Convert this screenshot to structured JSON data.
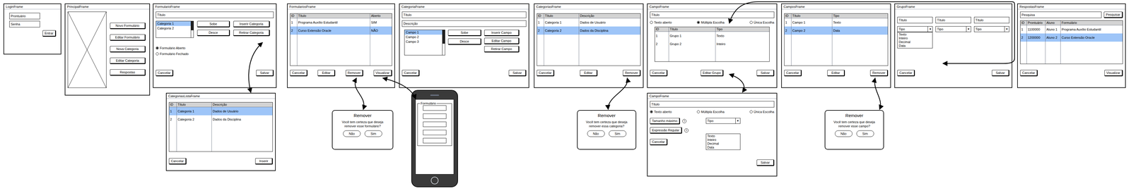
{
  "login": {
    "title": "LoginFrame",
    "fields": [
      "Prontuário",
      "Senha"
    ],
    "button": "Entrar"
  },
  "principal": {
    "title": "PrincipalFrame",
    "buttons": [
      "Novo Formulário",
      "Editar Formulário",
      "Nova Categoria",
      "Editar Categoria",
      "Respostas"
    ]
  },
  "formulario": {
    "title": "FormularioFrame",
    "field": "Título",
    "list": [
      {
        "label": "Categoria 1",
        "selected": true
      },
      {
        "label": "Categoria 2",
        "selected": false
      }
    ],
    "move_buttons": [
      "Sobe",
      "Desce"
    ],
    "action_buttons": [
      "Inserir Categoria",
      "Retirar Categoria"
    ],
    "radios": [
      {
        "label": "Formulário Aberto",
        "selected": true
      },
      {
        "label": "Formulário Fechado",
        "selected": false
      }
    ],
    "buttons": [
      "Cancelar",
      "Salvar"
    ]
  },
  "formularios": {
    "title": "FormulariosFrame",
    "table": {
      "columns": [
        "ID",
        "Título",
        "Aberto"
      ],
      "rows": [
        {
          "cells": [
            "1",
            "Programa Auxílio Estudantil",
            "SIM"
          ],
          "selected": false
        },
        {
          "cells": [
            "2",
            "Curso Extensão Oracle",
            "NÃO"
          ],
          "selected": true
        }
      ]
    },
    "buttons": [
      "Cancelar",
      "Editar",
      "Remover",
      "Visualizar"
    ]
  },
  "categoria": {
    "title": "CategoriaFrame",
    "fields": [
      "Título",
      "Descrição"
    ],
    "list": [
      {
        "label": "Campo 1",
        "selected": true
      },
      {
        "label": "Campo 2",
        "selected": false
      },
      {
        "label": "Campo 3",
        "selected": false
      }
    ],
    "move_buttons": [
      "Sobe",
      "Desce"
    ],
    "action_buttons": [
      "Inserir Campo",
      "Editar Campo",
      "Retirar Campo"
    ],
    "buttons": [
      "Cancelar",
      "Salvar"
    ]
  },
  "categorias": {
    "title": "CategoriasFrame",
    "table": {
      "columns": [
        "ID",
        "Título",
        "Descrição"
      ],
      "rows": [
        {
          "cells": [
            "1",
            "Categoria 1",
            "Dados de Usuário"
          ],
          "selected": false
        },
        {
          "cells": [
            "2",
            "Categoria 2",
            "Dados da Disciplina"
          ],
          "selected": true
        }
      ]
    },
    "buttons": [
      "Cancelar",
      "Editar",
      "Remover"
    ]
  },
  "campo": {
    "title": "CampoFrame",
    "field": "Título",
    "radios": [
      {
        "label": "Texto aberto",
        "selected": false
      },
      {
        "label": "Múltipla Escolha",
        "selected": true
      },
      {
        "label": "Única Escolha",
        "selected": false
      }
    ],
    "table": {
      "columns": [
        "ID",
        "Título",
        "Tipo"
      ],
      "rows": [
        {
          "cells": [
            "1",
            "Grupo 1",
            "Texto"
          ],
          "selected": false
        },
        {
          "cells": [
            "2",
            "Grupo 2",
            "Inteiro"
          ],
          "selected": false
        }
      ]
    },
    "buttons": [
      "Cancelar",
      "Editar Grupo",
      "Salvar"
    ]
  },
  "campos": {
    "title": "CamposFrame",
    "table": {
      "columns": [
        "ID",
        "Título",
        "Tipo"
      ],
      "rows": [
        {
          "cells": [
            "1",
            "Campo 1",
            "Texto"
          ],
          "selected": false
        },
        {
          "cells": [
            "2",
            "Campo 2",
            "Data"
          ],
          "selected": true
        }
      ]
    },
    "buttons": [
      "Cancelar",
      "Editar",
      "Remover"
    ]
  },
  "grupo": {
    "title": "GrupoFrame",
    "columns": [
      {
        "field": "Título",
        "dropdown": {
          "label": "Tipo",
          "arrow": "▼",
          "open": true,
          "options": [
            "Texto",
            "Inteiro",
            "Decimal",
            "Data"
          ]
        }
      },
      {
        "field": "Título",
        "dropdown": {
          "label": "Tipo",
          "arrow": "▼",
          "open": false
        }
      },
      {
        "field": "Título",
        "dropdown": {
          "label": "Tipo",
          "arrow": "▼",
          "open": false
        }
      }
    ],
    "buttons": [
      "Cancelar",
      "Salvar"
    ]
  },
  "respostas": {
    "title": "RespostasFrame",
    "search": {
      "placeholder": "Pesquisa",
      "button": "Pesquisar"
    },
    "table": {
      "columns": [
        "ID",
        "Prontuário",
        "Aluno",
        "Formulário"
      ],
      "rows": [
        {
          "cells": [
            "1",
            "1100000",
            "Aluno 1",
            "Programa Auxílio Estudantil"
          ],
          "selected": false
        },
        {
          "cells": [
            "2",
            "1200000",
            "Aluno 2",
            "Curso Extensão Oracle"
          ],
          "selected": true
        }
      ]
    },
    "buttons": [
      "Cancelar",
      "Visualizar"
    ]
  },
  "categorias_lista": {
    "title": "CategoriasListaFrame",
    "table": {
      "columns": [
        "ID",
        "Título",
        "Descrição"
      ],
      "rows": [
        {
          "cells": [
            "1",
            "Categoria 1",
            "Dados de Usuário"
          ],
          "selected": true
        },
        {
          "cells": [
            "2",
            "Categoria 2",
            "Dados da Disciplina"
          ],
          "selected": false
        }
      ]
    },
    "buttons": [
      "Cancelar",
      "Inserir"
    ]
  },
  "dialogs": [
    {
      "title": "Remover",
      "message": "Você tem certeza que deseja remover esse formulário?",
      "buttons": [
        "Não",
        "Sim"
      ]
    },
    {
      "title": "Remover",
      "message": "Você tem certeza que deseja remover essa categoria?",
      "buttons": [
        "Não",
        "Sim"
      ]
    },
    {
      "title": "Remover",
      "message": "Você tem certeza que deseja remover esse campo?",
      "buttons": [
        "Não",
        "Sim"
      ]
    }
  ],
  "phone": {
    "legend": "Formulário"
  },
  "campo_detalhe": {
    "title": "CampoFrame",
    "field": "Título",
    "radios": [
      {
        "label": "Texto aberto",
        "selected": true
      },
      {
        "label": "Múltipla Escolha",
        "selected": false
      },
      {
        "label": "Única Escolha",
        "selected": false
      }
    ],
    "options": [
      {
        "label": "Tamanho máximo",
        "help": "?"
      },
      {
        "label": "Expressão Regular",
        "help": "?"
      }
    ],
    "dropdown": {
      "label": "Tipo",
      "arrow": "▼",
      "open": true,
      "options": [
        "Texto",
        "Inteiro",
        "Decimal",
        "Data"
      ]
    },
    "buttons": [
      "Cancelar",
      "Salvar"
    ]
  }
}
